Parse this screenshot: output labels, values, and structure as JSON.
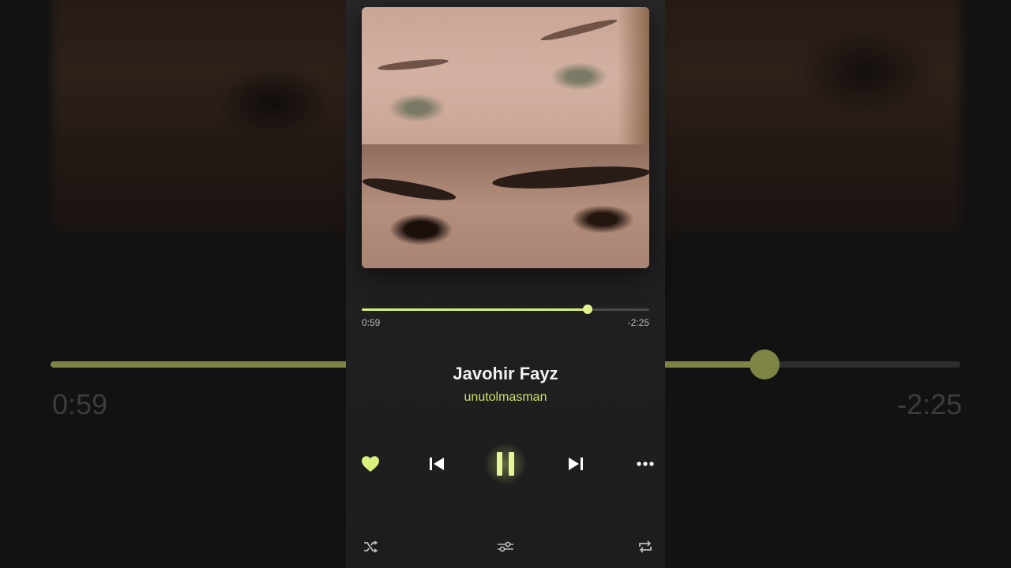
{
  "player": {
    "track_title": "Javohir Fayz",
    "track_subtitle": "unutolmasman",
    "elapsed": "0:59",
    "remaining": "-2:25",
    "progress_fraction": 0.785,
    "liked": true,
    "state": "playing"
  },
  "colors": {
    "accent": "#d8f07c",
    "accent_dim": "#cbe36a",
    "panel_bg": "#1f201f",
    "text_primary": "#f2f2f2",
    "text_secondary": "#b9b9b6"
  },
  "icons": {
    "like": "heart-icon",
    "previous": "skip-previous-icon",
    "play_pause": "pause-icon",
    "next": "skip-next-icon",
    "more": "more-horizontal-icon",
    "shuffle": "shuffle-icon",
    "equalizer": "equalizer-icon",
    "repeat": "repeat-icon"
  }
}
